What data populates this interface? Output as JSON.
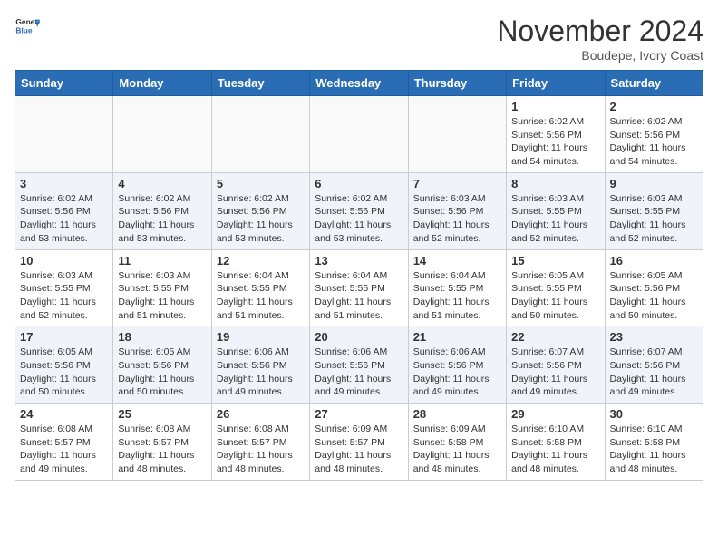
{
  "header": {
    "logo_general": "General",
    "logo_blue": "Blue",
    "month": "November 2024",
    "location": "Boudepe, Ivory Coast"
  },
  "days_of_week": [
    "Sunday",
    "Monday",
    "Tuesday",
    "Wednesday",
    "Thursday",
    "Friday",
    "Saturday"
  ],
  "weeks": [
    [
      {
        "day": "",
        "info": ""
      },
      {
        "day": "",
        "info": ""
      },
      {
        "day": "",
        "info": ""
      },
      {
        "day": "",
        "info": ""
      },
      {
        "day": "",
        "info": ""
      },
      {
        "day": "1",
        "info": "Sunrise: 6:02 AM\nSunset: 5:56 PM\nDaylight: 11 hours\nand 54 minutes."
      },
      {
        "day": "2",
        "info": "Sunrise: 6:02 AM\nSunset: 5:56 PM\nDaylight: 11 hours\nand 54 minutes."
      }
    ],
    [
      {
        "day": "3",
        "info": "Sunrise: 6:02 AM\nSunset: 5:56 PM\nDaylight: 11 hours\nand 53 minutes."
      },
      {
        "day": "4",
        "info": "Sunrise: 6:02 AM\nSunset: 5:56 PM\nDaylight: 11 hours\nand 53 minutes."
      },
      {
        "day": "5",
        "info": "Sunrise: 6:02 AM\nSunset: 5:56 PM\nDaylight: 11 hours\nand 53 minutes."
      },
      {
        "day": "6",
        "info": "Sunrise: 6:02 AM\nSunset: 5:56 PM\nDaylight: 11 hours\nand 53 minutes."
      },
      {
        "day": "7",
        "info": "Sunrise: 6:03 AM\nSunset: 5:56 PM\nDaylight: 11 hours\nand 52 minutes."
      },
      {
        "day": "8",
        "info": "Sunrise: 6:03 AM\nSunset: 5:55 PM\nDaylight: 11 hours\nand 52 minutes."
      },
      {
        "day": "9",
        "info": "Sunrise: 6:03 AM\nSunset: 5:55 PM\nDaylight: 11 hours\nand 52 minutes."
      }
    ],
    [
      {
        "day": "10",
        "info": "Sunrise: 6:03 AM\nSunset: 5:55 PM\nDaylight: 11 hours\nand 52 minutes."
      },
      {
        "day": "11",
        "info": "Sunrise: 6:03 AM\nSunset: 5:55 PM\nDaylight: 11 hours\nand 51 minutes."
      },
      {
        "day": "12",
        "info": "Sunrise: 6:04 AM\nSunset: 5:55 PM\nDaylight: 11 hours\nand 51 minutes."
      },
      {
        "day": "13",
        "info": "Sunrise: 6:04 AM\nSunset: 5:55 PM\nDaylight: 11 hours\nand 51 minutes."
      },
      {
        "day": "14",
        "info": "Sunrise: 6:04 AM\nSunset: 5:55 PM\nDaylight: 11 hours\nand 51 minutes."
      },
      {
        "day": "15",
        "info": "Sunrise: 6:05 AM\nSunset: 5:55 PM\nDaylight: 11 hours\nand 50 minutes."
      },
      {
        "day": "16",
        "info": "Sunrise: 6:05 AM\nSunset: 5:56 PM\nDaylight: 11 hours\nand 50 minutes."
      }
    ],
    [
      {
        "day": "17",
        "info": "Sunrise: 6:05 AM\nSunset: 5:56 PM\nDaylight: 11 hours\nand 50 minutes."
      },
      {
        "day": "18",
        "info": "Sunrise: 6:05 AM\nSunset: 5:56 PM\nDaylight: 11 hours\nand 50 minutes."
      },
      {
        "day": "19",
        "info": "Sunrise: 6:06 AM\nSunset: 5:56 PM\nDaylight: 11 hours\nand 49 minutes."
      },
      {
        "day": "20",
        "info": "Sunrise: 6:06 AM\nSunset: 5:56 PM\nDaylight: 11 hours\nand 49 minutes."
      },
      {
        "day": "21",
        "info": "Sunrise: 6:06 AM\nSunset: 5:56 PM\nDaylight: 11 hours\nand 49 minutes."
      },
      {
        "day": "22",
        "info": "Sunrise: 6:07 AM\nSunset: 5:56 PM\nDaylight: 11 hours\nand 49 minutes."
      },
      {
        "day": "23",
        "info": "Sunrise: 6:07 AM\nSunset: 5:56 PM\nDaylight: 11 hours\nand 49 minutes."
      }
    ],
    [
      {
        "day": "24",
        "info": "Sunrise: 6:08 AM\nSunset: 5:57 PM\nDaylight: 11 hours\nand 49 minutes."
      },
      {
        "day": "25",
        "info": "Sunrise: 6:08 AM\nSunset: 5:57 PM\nDaylight: 11 hours\nand 48 minutes."
      },
      {
        "day": "26",
        "info": "Sunrise: 6:08 AM\nSunset: 5:57 PM\nDaylight: 11 hours\nand 48 minutes."
      },
      {
        "day": "27",
        "info": "Sunrise: 6:09 AM\nSunset: 5:57 PM\nDaylight: 11 hours\nand 48 minutes."
      },
      {
        "day": "28",
        "info": "Sunrise: 6:09 AM\nSunset: 5:58 PM\nDaylight: 11 hours\nand 48 minutes."
      },
      {
        "day": "29",
        "info": "Sunrise: 6:10 AM\nSunset: 5:58 PM\nDaylight: 11 hours\nand 48 minutes."
      },
      {
        "day": "30",
        "info": "Sunrise: 6:10 AM\nSunset: 5:58 PM\nDaylight: 11 hours\nand 48 minutes."
      }
    ]
  ]
}
